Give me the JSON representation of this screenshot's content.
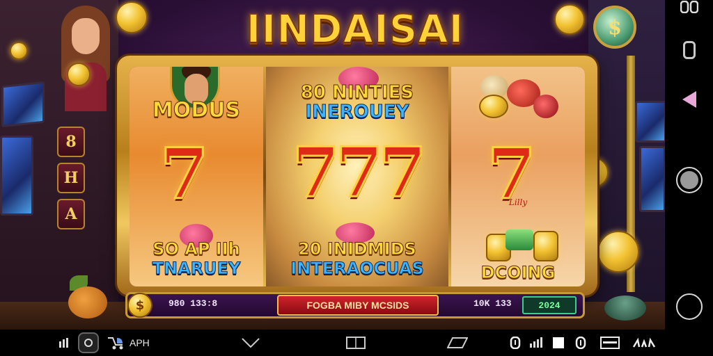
{
  "game": {
    "title": "IINDAISAI",
    "side_tiles": [
      "8",
      "H",
      "A"
    ],
    "lamp_symbol": "$"
  },
  "reels": {
    "left": {
      "top_label": "MODUS",
      "center_symbol": "7",
      "bottom_line1": "SO AP IIh",
      "bottom_line2": "TNARUEY"
    },
    "middle": {
      "top_line1": "80 NINTIES",
      "top_line2": "INEROUEY",
      "center_symbol": "777",
      "bottom_line1": "20 INIDMIDS",
      "bottom_line2": "INTERAOCUAS"
    },
    "right": {
      "center_symbol": "7",
      "script_mark": "Lilly",
      "bottom_label": "DCOING"
    }
  },
  "bottom_bar": {
    "coin_symbol": "$",
    "left_value": "980 133:8",
    "spin_label": "FOGBA MIBY MCSIDS",
    "right_value": "10K 133",
    "credit_value": "2024"
  },
  "status_bar": {
    "app_label": "APH"
  },
  "colors": {
    "title_gold": "#ffd23a",
    "seven_red": "#e02a18",
    "label_blue": "#3ab6ff",
    "spin_red": "#d0242a",
    "credit_green": "#7aff9a"
  }
}
